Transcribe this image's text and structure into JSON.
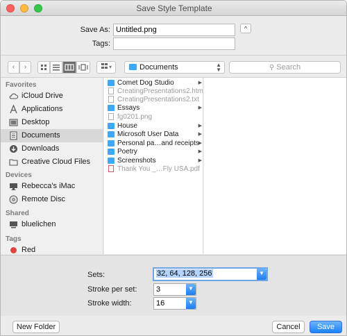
{
  "window": {
    "title": "Save Style Template"
  },
  "save_as": {
    "label": "Save As:",
    "value": "Untitled.png",
    "tags_label": "Tags:",
    "tags_value": "",
    "expand_glyph": "^"
  },
  "toolbar": {
    "back_icon": "chevron-left-icon",
    "forward_icon": "chevron-right-icon",
    "views": [
      "icon-view",
      "list-view",
      "column-view",
      "coverflow-view"
    ],
    "active_view": "column-view",
    "arrange_glyph": "▾",
    "location": "Documents",
    "search_placeholder": "Search"
  },
  "sidebar": {
    "favorites_header": "Favorites",
    "favorites": [
      {
        "label": "iCloud Drive",
        "icon": "cloud-icon"
      },
      {
        "label": "Applications",
        "icon": "applications-icon"
      },
      {
        "label": "Desktop",
        "icon": "desktop-icon"
      },
      {
        "label": "Documents",
        "icon": "documents-icon",
        "selected": true
      },
      {
        "label": "Downloads",
        "icon": "downloads-icon"
      },
      {
        "label": "Creative Cloud Files",
        "icon": "folder-icon"
      }
    ],
    "devices_header": "Devices",
    "devices": [
      {
        "label": "Rebecca's iMac",
        "icon": "imac-icon"
      },
      {
        "label": "Remote Disc",
        "icon": "disc-icon"
      }
    ],
    "shared_header": "Shared",
    "shared": [
      {
        "label": "bluelichen",
        "icon": "computer-icon"
      }
    ],
    "tags_header": "Tags",
    "tags": [
      {
        "label": "Red",
        "color": "#e0443e"
      }
    ]
  },
  "files": [
    {
      "name": "Comet Dog Studio",
      "kind": "folder",
      "expandable": true
    },
    {
      "name": "CreatingPresentations2.html",
      "kind": "doc",
      "dim": true
    },
    {
      "name": "CreatingPresentations2.txt",
      "kind": "doc",
      "dim": true
    },
    {
      "name": "Essays",
      "kind": "folder",
      "expandable": true
    },
    {
      "name": "fg0201.png",
      "kind": "doc",
      "dim": true
    },
    {
      "name": "House",
      "kind": "folder",
      "expandable": true
    },
    {
      "name": "Microsoft User Data",
      "kind": "folder",
      "expandable": true
    },
    {
      "name": "Personal pa…and receipts",
      "kind": "folder",
      "expandable": true
    },
    {
      "name": "Poetry",
      "kind": "folder",
      "expandable": true
    },
    {
      "name": "Screenshots",
      "kind": "folder",
      "expandable": true
    },
    {
      "name": "Thank You _…Fly USA.pdf",
      "kind": "pdf",
      "dim": true
    }
  ],
  "options": {
    "sets_label": "Sets:",
    "sets_value": "32, 64, 128, 256",
    "stroke_per_set_label": "Stroke per set:",
    "stroke_per_set_value": "3",
    "stroke_width_label": "Stroke width:",
    "stroke_width_value": "16"
  },
  "footer": {
    "new_folder": "New Folder",
    "cancel": "Cancel",
    "save": "Save"
  },
  "colors": {
    "accent": "#1a82fb",
    "folder": "#3fa9f5",
    "selection": "#d8d8d8"
  }
}
